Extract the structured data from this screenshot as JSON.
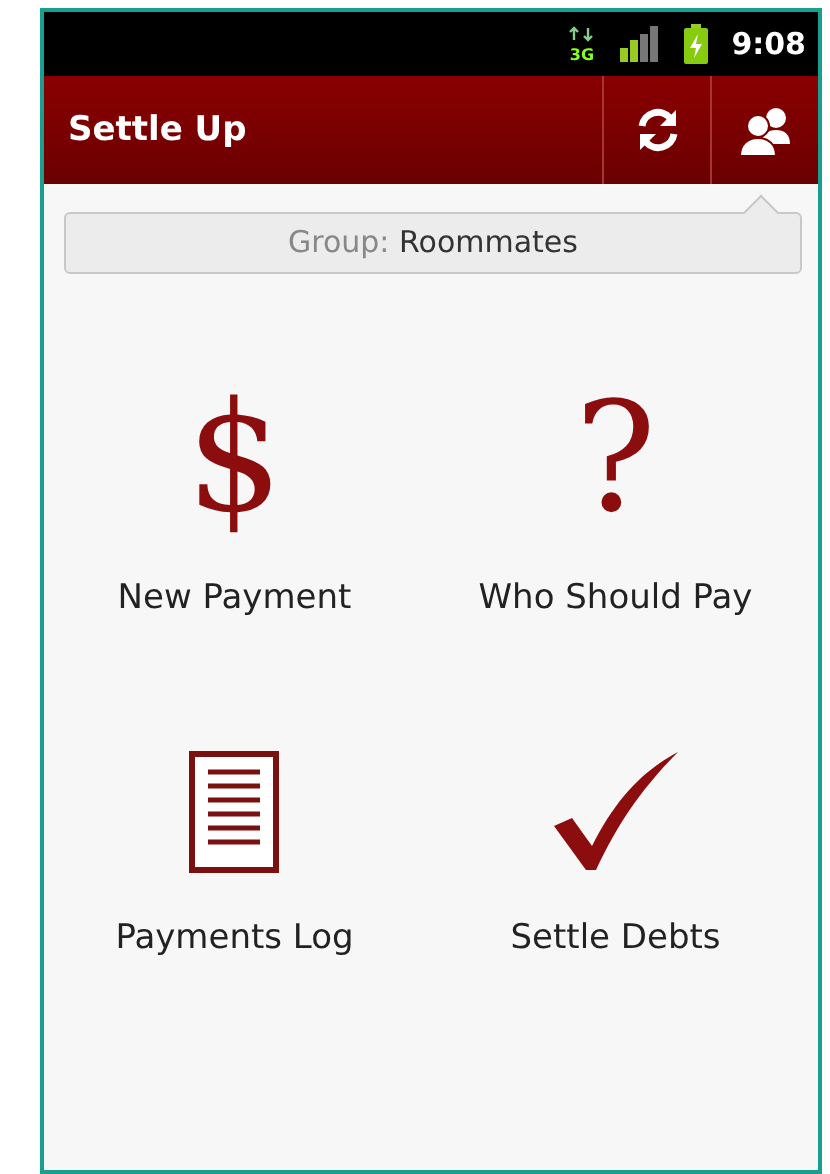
{
  "status_bar": {
    "network_type": "3G",
    "time": "9:08"
  },
  "action_bar": {
    "title": "Settle Up"
  },
  "group_tooltip": {
    "label": "Group:",
    "value": "Roommates"
  },
  "dashboard": [
    {
      "kind": "glyph",
      "glyph": "$",
      "label": "New Payment"
    },
    {
      "kind": "glyph",
      "glyph": "?",
      "label": "Who Should Pay"
    },
    {
      "kind": "document",
      "label": "Payments Log"
    },
    {
      "kind": "check",
      "label": "Settle Debts"
    }
  ]
}
